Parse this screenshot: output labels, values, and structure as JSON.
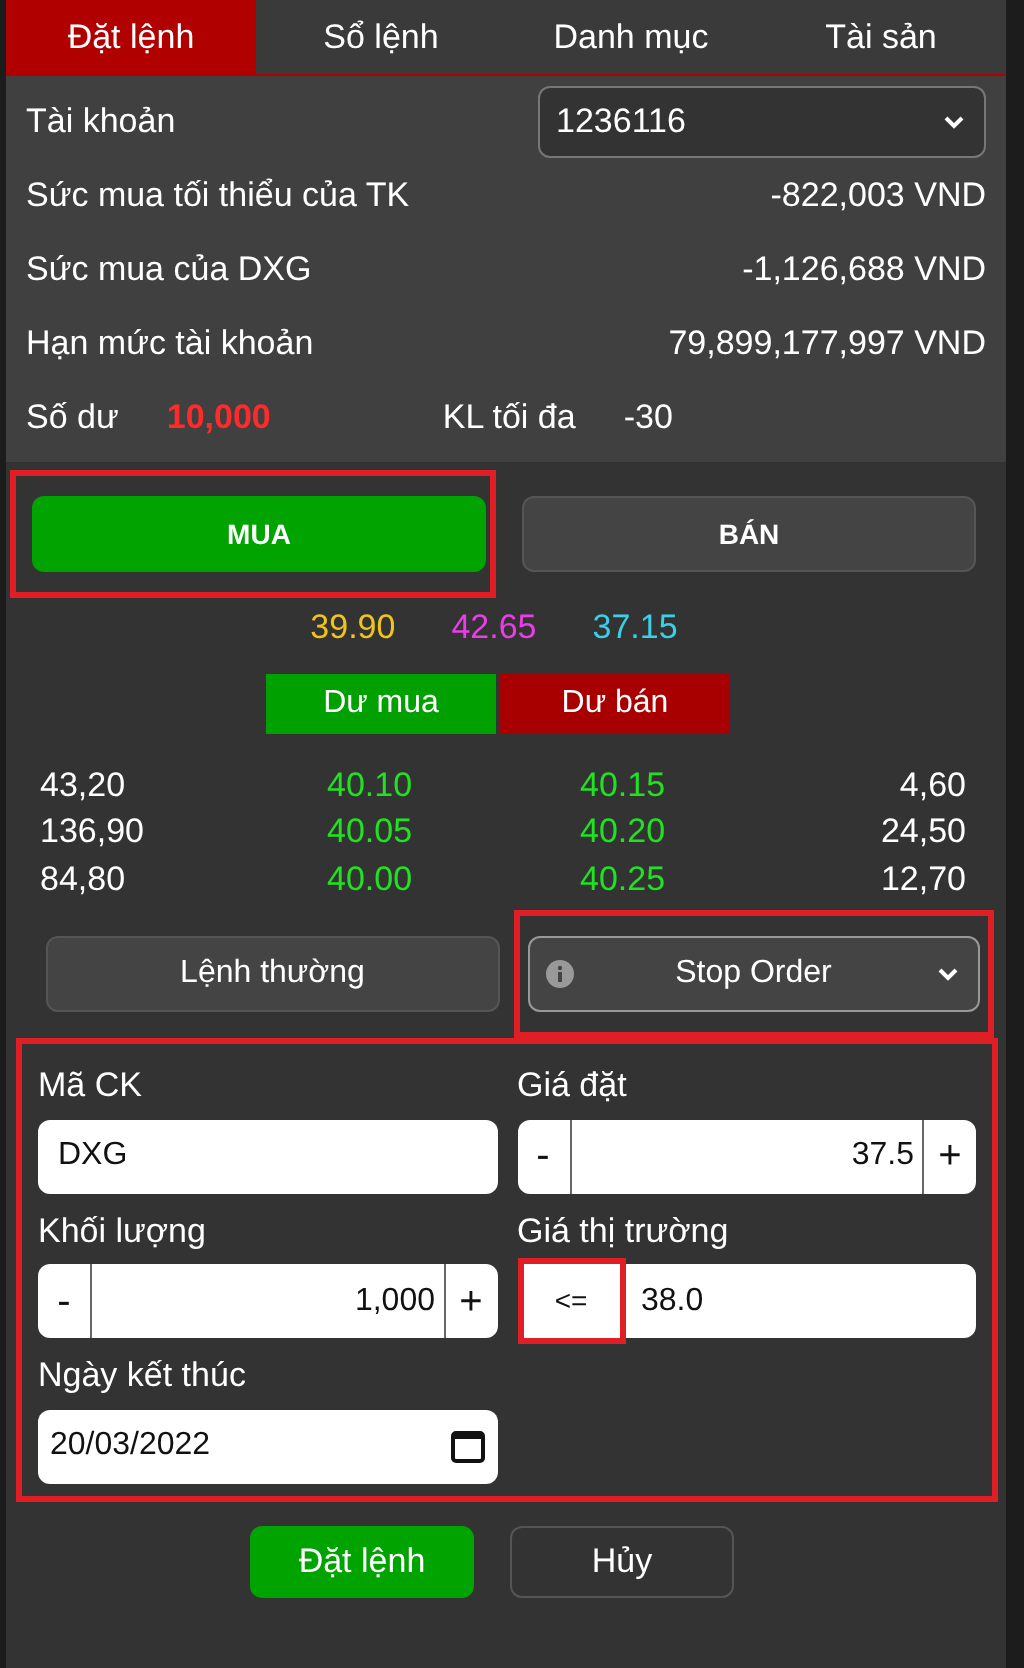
{
  "tabs": [
    {
      "label": "Đặt lệnh",
      "selected": true
    },
    {
      "label": "Sổ lệnh",
      "selected": false
    },
    {
      "label": "Danh mục",
      "selected": false
    },
    {
      "label": "Tài sản",
      "selected": false
    }
  ],
  "account": {
    "label": "Tài khoản",
    "value": "1236116"
  },
  "info_rows": [
    {
      "label": "Sức mua tối thiểu của TK",
      "value": "-822,003 VND"
    },
    {
      "label": "Sức mua của DXG",
      "value": "-1,126,688 VND"
    },
    {
      "label": "Hạn mức tài khoản",
      "value": "79,899,177,997 VND"
    }
  ],
  "balance": {
    "label": "Số dư",
    "value": "10,000"
  },
  "max_qty": {
    "label": "KL tối đa",
    "value": "-30"
  },
  "sides": [
    {
      "label": "MUA",
      "kind": "buy",
      "selected": true,
      "highlighted": true
    },
    {
      "label": "BÁN",
      "kind": "sell",
      "selected": false,
      "highlighted": false
    }
  ],
  "prices": [
    {
      "value": "39.90",
      "color": "#f0c419"
    },
    {
      "value": "42.65",
      "color": "#e83ee8"
    },
    {
      "value": "37.15",
      "color": "#3ad0e8"
    }
  ],
  "depth_headers": [
    {
      "label": "Dư mua",
      "color": "#00a000"
    },
    {
      "label": "Dư bán",
      "color": "#a80000"
    }
  ],
  "depth_rows": [
    {
      "bid_volume": "43,20",
      "bid_price": "40.10",
      "ask_price": "40.15",
      "ask_volume": "4,60"
    },
    {
      "bid_volume": "136,90",
      "bid_price": "40.05",
      "ask_price": "40.20",
      "ask_volume": "24,50"
    },
    {
      "bid_volume": "84,80",
      "bid_price": "40.00",
      "ask_price": "40.25",
      "ask_volume": "12,70"
    }
  ],
  "order_types": [
    {
      "label": "Lệnh thường",
      "kind": "button",
      "highlighted": false
    },
    {
      "label": "Stop Order",
      "kind": "select",
      "highlighted": true
    }
  ],
  "form": {
    "highlighted": true,
    "fields": [
      {
        "label": "Mã CK",
        "kind": "text",
        "value": "DXG"
      },
      {
        "label": "Giá đặt",
        "kind": "stepper",
        "value": "37.5",
        "minus": "-",
        "plus": "+"
      },
      {
        "label": "Khối lượng",
        "kind": "stepper",
        "value": "1,000",
        "minus": "-",
        "plus": "+"
      },
      {
        "label": "Giá thị trường",
        "kind": "condition",
        "operator": "<=",
        "operator_highlighted": true,
        "value": "38.0"
      },
      {
        "label": "Ngày kết thúc",
        "kind": "date",
        "value": "20/03/2022"
      }
    ]
  },
  "actions": [
    {
      "label": "Đặt lệnh",
      "kind": "primary"
    },
    {
      "label": "Hủy",
      "kind": "secondary"
    }
  ]
}
